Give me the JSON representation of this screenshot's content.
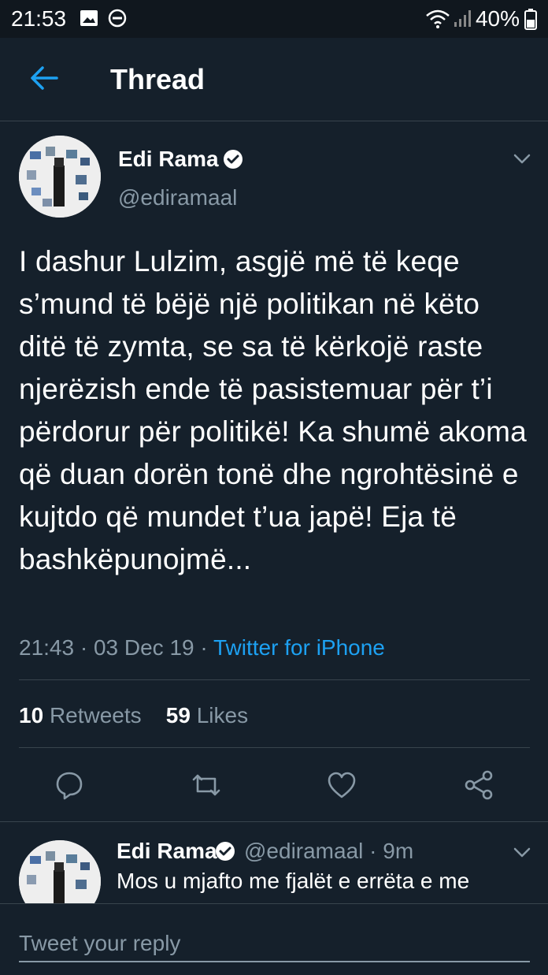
{
  "status_bar": {
    "time": "21:53",
    "battery": "40%"
  },
  "header": {
    "title": "Thread"
  },
  "tweet": {
    "name": "Edi Rama",
    "handle": "@ediramaal",
    "text": "I dashur Lulzim, asgjë më të keqe s’mund të bëjë një politikan në këto ditë të zymta, se sa të kërkojë raste njerëzish ende të pasistemuar për t’i përdorur për politikë! Ka shumë akoma që duan dorën tonë dhe ngrohtësinë e kujtdo që mundet t’ua japë! Eja të bashkëpunojmë...",
    "time": "21:43",
    "date": "03 Dec 19",
    "source": "Twitter for iPhone",
    "retweets": "10",
    "retweets_label": "Retweets",
    "likes": "59",
    "likes_label": "Likes"
  },
  "reply": {
    "name": "Edi Rama",
    "handle": "@ediramaal",
    "time": "9m",
    "text": "Mos u mjafto me fjalët e errëta e me"
  },
  "composer": {
    "placeholder": "Tweet your reply"
  },
  "colors": {
    "background": "#15202b",
    "accent": "#1da1f2",
    "muted": "#8899a6"
  }
}
